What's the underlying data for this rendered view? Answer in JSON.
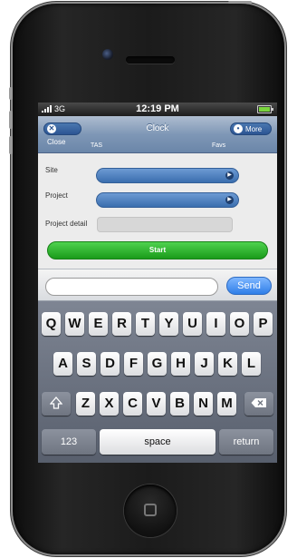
{
  "status_bar": {
    "signal": "3G",
    "time": "12:19 PM"
  },
  "nav": {
    "close_label": "Close",
    "title": "Clock",
    "more_label": "More",
    "tabs": [
      "TAS",
      "Favs"
    ]
  },
  "form": {
    "site_label": "Site",
    "project_label": "Project",
    "detail_label": "Project detail",
    "start_label": "Start"
  },
  "message": {
    "placeholder": "",
    "send_label": "Send"
  },
  "keyboard": {
    "row1": [
      "Q",
      "W",
      "E",
      "R",
      "T",
      "Y",
      "U",
      "I",
      "O",
      "P"
    ],
    "row2": [
      "A",
      "S",
      "D",
      "F",
      "G",
      "H",
      "J",
      "K",
      "L"
    ],
    "row3": [
      "Z",
      "X",
      "C",
      "V",
      "B",
      "N",
      "M"
    ],
    "numbers_label": "123",
    "space_label": "space",
    "return_label": "return"
  },
  "colors": {
    "nav_blue": "#6b86a9",
    "select_blue": "#3a6eae",
    "start_green": "#1a9b1a",
    "send_blue": "#2f7ee8"
  },
  "icons": [
    "close-icon",
    "more-icon",
    "chevron-right-icon",
    "shift-icon",
    "backspace-icon",
    "battery-icon"
  ]
}
